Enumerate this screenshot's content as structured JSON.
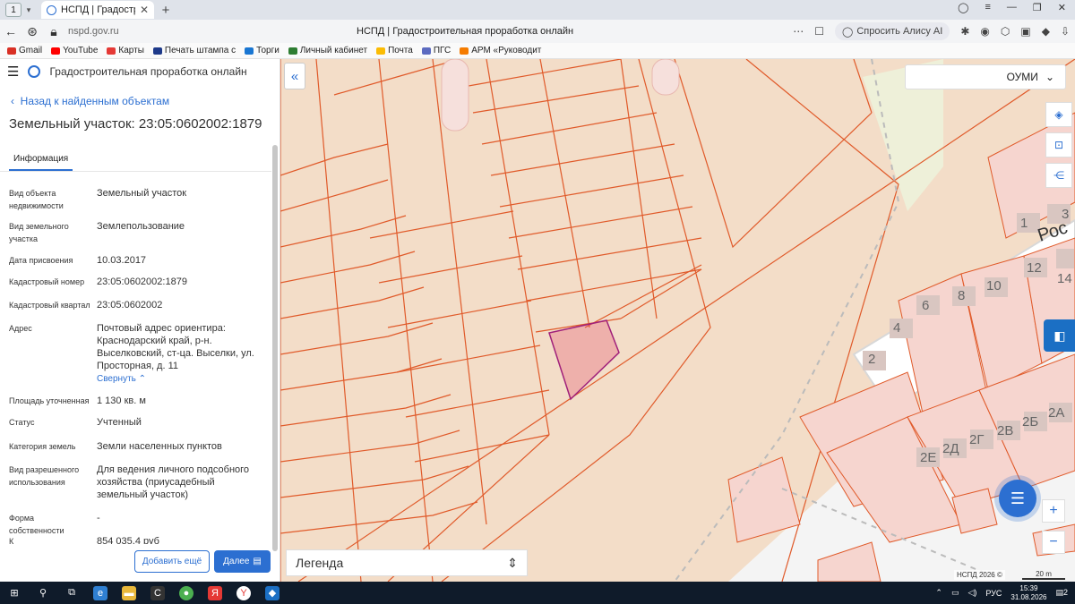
{
  "browser": {
    "tab_number": "1",
    "tab_title": "НСПД | Градостроительн",
    "url": "nspd.gov.ru",
    "page_title": "НСПД | Градостроительная проработка онлайн",
    "alisa_label": "Спросить Алису AI",
    "bookmarks": [
      {
        "label": "Gmail",
        "color": "#d93025"
      },
      {
        "label": "YouTube",
        "color": "#ff0000"
      },
      {
        "label": "Карты",
        "color": "#e53935"
      },
      {
        "label": "Печать штампа с",
        "color": "#1e3a8a"
      },
      {
        "label": "Торги",
        "color": "#1976d2"
      },
      {
        "label": "Личный кабинет",
        "color": "#2e7d32"
      },
      {
        "label": "Почта",
        "color": "#fbbc04"
      },
      {
        "label": "ПГС",
        "color": "#5c6bc0"
      },
      {
        "label": "АРМ «Руководит",
        "color": "#f57c00"
      }
    ]
  },
  "panel": {
    "app_name": "Градостроительная проработка онлайн",
    "back_label": "Назад к найденным объектам",
    "title": "Земельный участок: 23:05:0602002:1879",
    "tab_label": "Информация",
    "fields": [
      {
        "label": "Вид объекта недвижимости",
        "value": "Земельный участок"
      },
      {
        "label": "Вид земельного участка",
        "value": "Землепользование"
      },
      {
        "label": "Дата присвоения",
        "value": "10.03.2017"
      },
      {
        "label": "Кадастровый номер",
        "value": "23:05:0602002:1879"
      },
      {
        "label": "Кадастровый квартал",
        "value": "23:05:0602002"
      },
      {
        "label": "Адрес",
        "value": "Почтовый адрес ориентира: Краснодарский край, р-н. Выселковский, ст-ца. Выселки, ул. Просторная, д. 11"
      },
      {
        "label": "Площадь уточненная",
        "value": "1 130 кв. м"
      },
      {
        "label": "Статус",
        "value": "Учтенный"
      },
      {
        "label": "Категория земель",
        "value": "Земли населенных пунктов"
      },
      {
        "label": "Вид разрешенного использования",
        "value": "Для ведения личного подсобного хозяйства (приусадебный земельный участок)"
      },
      {
        "label": "Форма собственности",
        "value": "-"
      },
      {
        "label": "К",
        "value": "854 035,4 руб"
      }
    ],
    "collapse_label": "Свернуть",
    "add_button": "Добавить ещё",
    "next_button": "Далее"
  },
  "map": {
    "layer_select": "ОУМИ",
    "legend_label": "Легенда",
    "street_label": "Рос",
    "house_numbers": [
      "1",
      "3",
      "12",
      "14",
      "10",
      "8",
      "6",
      "4",
      "2",
      "2Е",
      "2Д",
      "2Г",
      "2В",
      "2Б",
      "2А"
    ],
    "copyright": "НСПД 2026 ©",
    "scale_label": "20 m",
    "parcel_color": "#e5486b",
    "boundary_color": "#e05a2a"
  },
  "taskbar": {
    "language": "РУС",
    "time": "15:39",
    "date": "31.08.2026",
    "notifications": "2"
  }
}
